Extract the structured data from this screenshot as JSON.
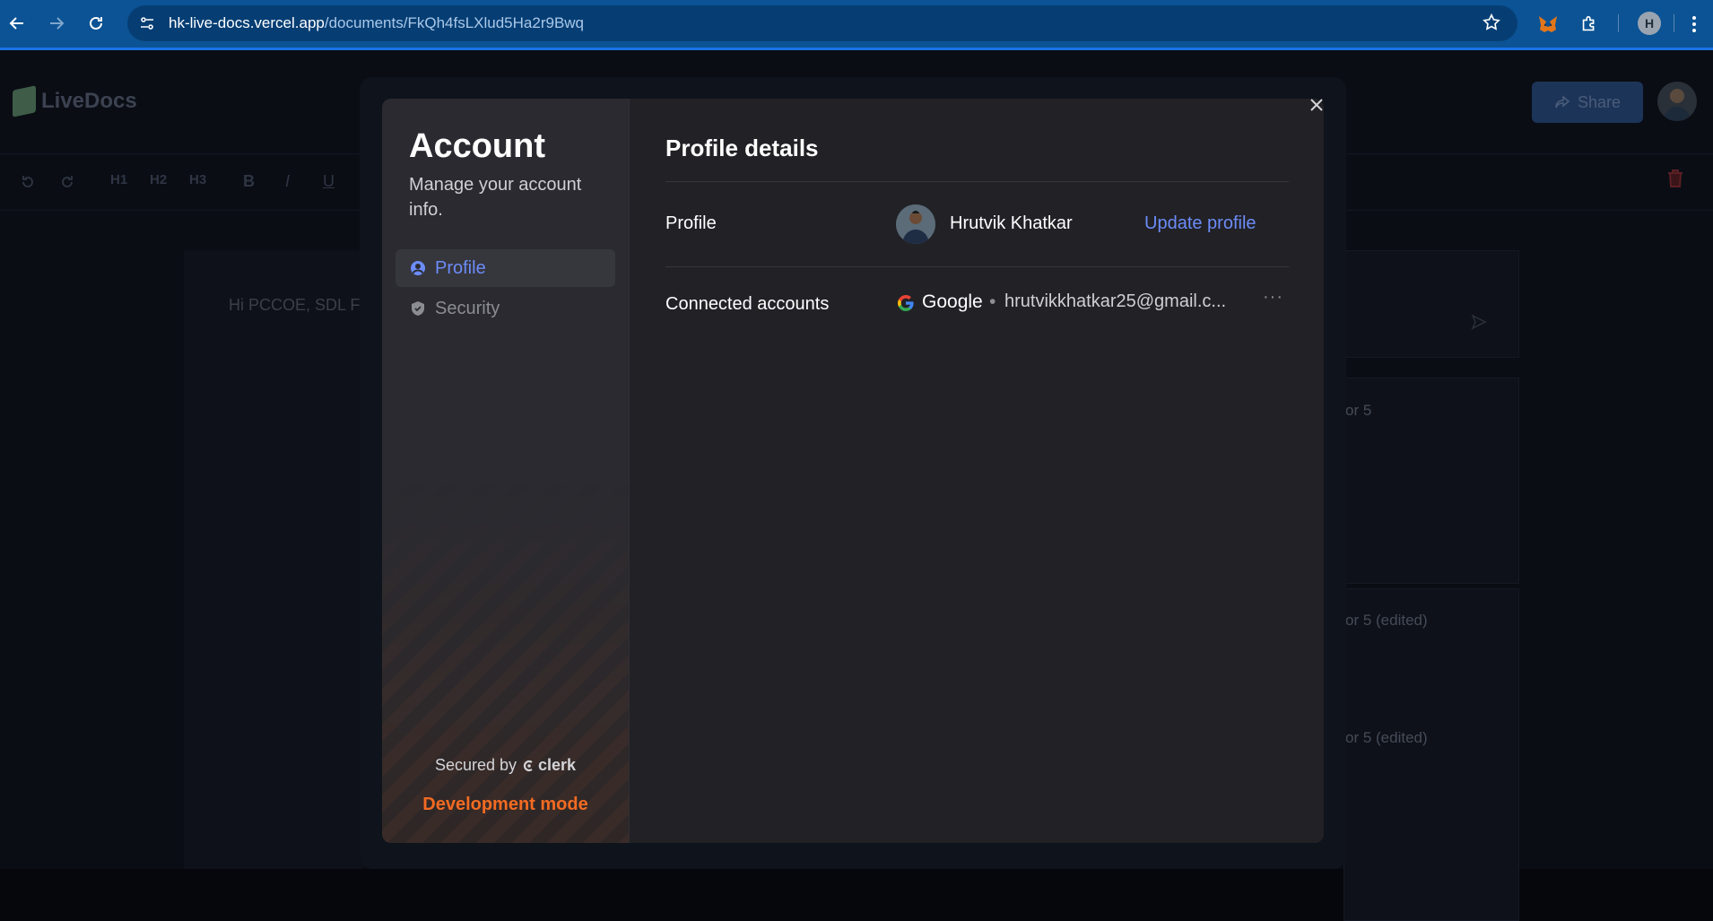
{
  "browser": {
    "url_host": "hk-live-docs.vercel.app",
    "url_path": "/documents/FkQh4fsLXlud5Ha2r9Bwq",
    "profile_initial": "H"
  },
  "app": {
    "logo_text": "LiveDocs",
    "share_label": "Share",
    "toolbar": [
      "H1",
      "H2",
      "H3",
      "B",
      "I",
      "U"
    ],
    "editor_snippet": "Hi PCCOE, SDL F",
    "comments": [
      "or 5",
      "or 5 (edited)",
      "or 5 (edited)"
    ]
  },
  "modal": {
    "sidebar": {
      "title": "Account",
      "subtitle": "Manage your account info.",
      "items": [
        {
          "label": "Profile",
          "icon": "user-circle-icon",
          "active": true
        },
        {
          "label": "Security",
          "icon": "shield-check-icon",
          "active": false
        }
      ],
      "secured_by": "Secured by",
      "clerk_brand": "clerk",
      "dev_mode": "Development mode"
    },
    "content": {
      "title": "Profile details",
      "profile_label": "Profile",
      "user_name": "Hrutvik Khatkar",
      "update_label": "Update profile",
      "connected_label": "Connected accounts",
      "provider": "Google",
      "separator": "•",
      "email": "hrutvikkhatkar25@gmail.c...",
      "more_label": "···"
    }
  },
  "colors": {
    "accent": "#6c8cf7",
    "dev_mode": "#f26b22",
    "browser_bar": "#0b5394"
  }
}
